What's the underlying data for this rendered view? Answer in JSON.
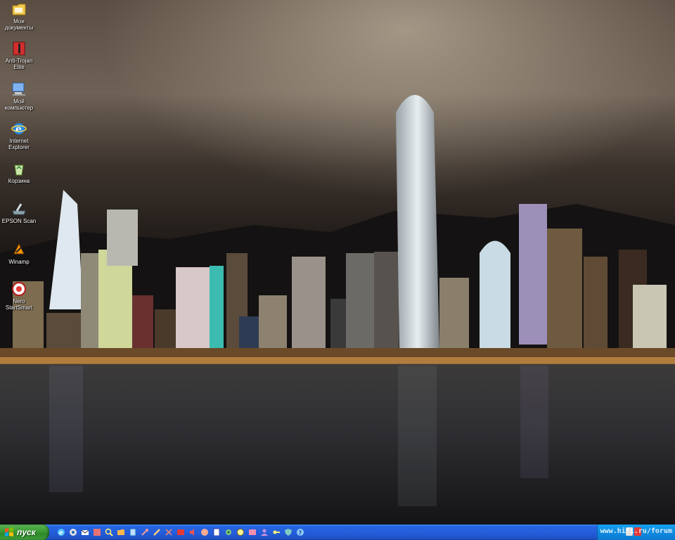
{
  "desktop": {
    "icons": [
      {
        "label": "Мои документы",
        "icon": "folder-documents-icon",
        "color": "#f2c94c"
      },
      {
        "label": "Anti-Trojan Elite",
        "icon": "antitrojan-icon",
        "color": "#d32f2f"
      },
      {
        "label": "Мой компьютер",
        "icon": "my-computer-icon",
        "color": "#7fb2f0"
      },
      {
        "label": "Internet Explorer",
        "icon": "internet-explorer-icon",
        "color": "#1e88e5"
      },
      {
        "label": "Корзина",
        "icon": "recycle-bin-icon",
        "color": "#8bc34a"
      },
      {
        "label": "EPSON Scan",
        "icon": "scanner-icon",
        "color": "#90a4ae"
      },
      {
        "label": "Winamp",
        "icon": "winamp-icon",
        "color": "#ff9800"
      },
      {
        "label": "Nero StartSmart",
        "icon": "nero-icon",
        "color": "#e53935"
      }
    ]
  },
  "taskbar": {
    "start_label": "пуск",
    "quicklaunch": [
      {
        "icon": "ie-quicklaunch-icon",
        "color": "#4fc3f7"
      },
      {
        "icon": "media-icon",
        "color": "#e0e0e0"
      },
      {
        "icon": "mail-icon",
        "color": "#ffffff"
      },
      {
        "icon": "paint-icon",
        "color": "#e57373"
      },
      {
        "icon": "search-icon",
        "color": "#fff176"
      },
      {
        "icon": "folder-icon",
        "color": "#ffb74d"
      },
      {
        "icon": "document-icon",
        "color": "#bbdefb"
      },
      {
        "icon": "tools-icon",
        "color": "#ef9a9a"
      },
      {
        "icon": "pen-icon",
        "color": "#ffcc80"
      },
      {
        "icon": "scissors-icon",
        "color": "#ff8a65"
      },
      {
        "icon": "red-app-icon",
        "color": "#e53935"
      },
      {
        "icon": "audio-icon",
        "color": "#ef5350"
      },
      {
        "icon": "globe-icon",
        "color": "#ffab91"
      },
      {
        "icon": "calculator-icon",
        "color": "#ffffff"
      },
      {
        "icon": "gear-icon",
        "color": "#81c784"
      },
      {
        "icon": "settings-icon",
        "color": "#fff59d"
      },
      {
        "icon": "image-icon",
        "color": "#f48fb1"
      },
      {
        "icon": "user-icon",
        "color": "#ce93d8"
      },
      {
        "icon": "key-icon",
        "color": "#fff176"
      },
      {
        "icon": "shield-icon",
        "color": "#80cbc4"
      },
      {
        "icon": "help-icon",
        "color": "#90caf9"
      }
    ],
    "tray_text": "www.hifi.ru/forum"
  }
}
